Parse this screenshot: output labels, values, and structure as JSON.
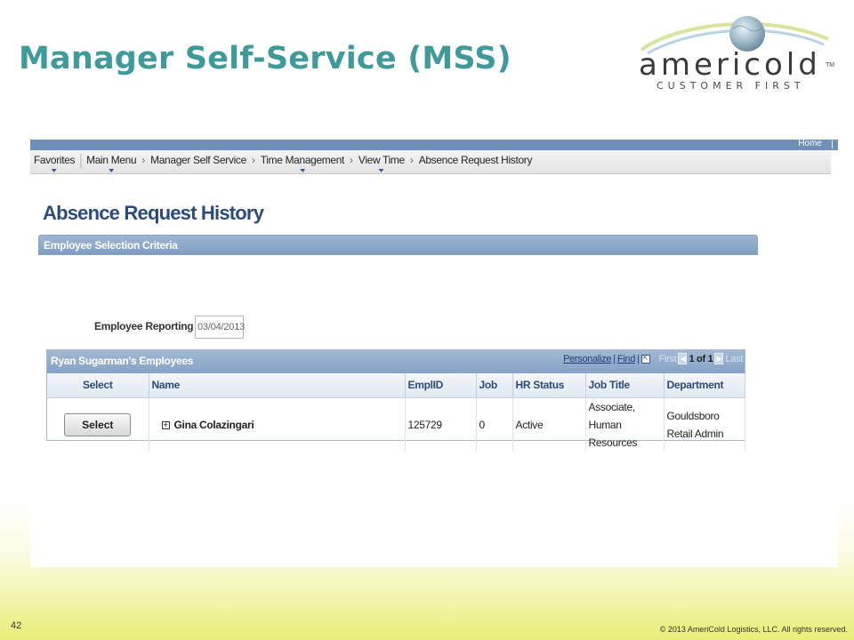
{
  "slide": {
    "title": "Manager Self-Service (MSS)",
    "page_number": "42",
    "copyright": "© 2013 AmeriCold Logistics, LLC. All rights reserved."
  },
  "logo": {
    "word": "americold",
    "tm": "TM",
    "tagline": "CUSTOMER FIRST"
  },
  "app": {
    "topbar": {
      "home_label": "Home"
    },
    "nav": {
      "items": [
        {
          "label": "Favorites",
          "has_dropdown": true
        },
        {
          "label": "Main Menu",
          "has_dropdown": true
        },
        {
          "label": "Manager Self Service",
          "has_dropdown": false
        },
        {
          "label": "Time Management",
          "has_dropdown": true
        },
        {
          "label": "View Time",
          "has_dropdown": true
        },
        {
          "label": "Absence Request History",
          "has_dropdown": false
        }
      ],
      "separator": "›"
    },
    "page_title": "Absence Request History",
    "criteria_section": {
      "title": "Employee Selection Criteria"
    },
    "reporting": {
      "label": "Employee Reporting as of",
      "date_value": "03/04/2013"
    },
    "grid": {
      "title": "Ryan Sugarman's Employees",
      "tools": {
        "personalize": "Personalize",
        "find": "Find",
        "first": "First",
        "range": "1 of 1",
        "last": "Last"
      },
      "columns": [
        "Select",
        "Name",
        "EmplID",
        "Job",
        "HR Status",
        "Job Title",
        "Department"
      ],
      "rows": [
        {
          "select_label": "Select",
          "name": "Gina Colazingari",
          "emplid": "125729",
          "job": "0",
          "hr_status": "Active",
          "job_title": "Associate, Human Resources",
          "department": "Gouldsboro Retail Admin"
        }
      ]
    }
  },
  "colors": {
    "title_teal": "#3f9a9a",
    "ps_blue_bar": "#6e8fb8",
    "heading_navy": "#2c4a7a",
    "footer_yellow": "#e9ee78"
  }
}
